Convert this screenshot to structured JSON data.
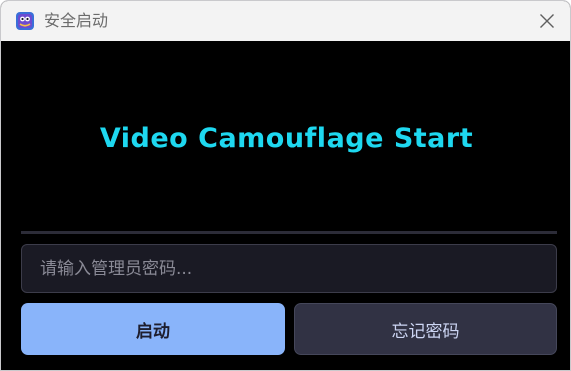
{
  "window": {
    "title": "安全启动",
    "app_icon": "app-logo-icon",
    "close_icon": "close-icon"
  },
  "main": {
    "headline": "Video Camouflage Start",
    "password_placeholder": "请输入管理员密码...",
    "start_label": "启动",
    "forgot_label": "忘记密码"
  },
  "colors": {
    "background": "#000000",
    "headline": "#1ed8f0",
    "primary_button": "#89b4fa",
    "secondary_button": "#313244",
    "input_background": "#1a1a24",
    "titlebar": "#f3f3f3"
  }
}
